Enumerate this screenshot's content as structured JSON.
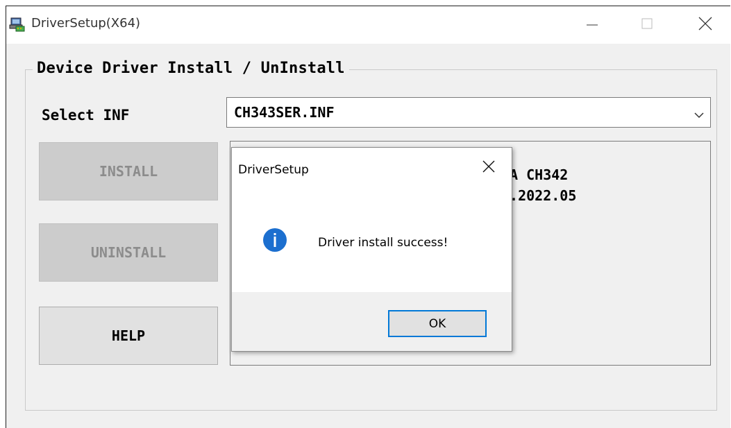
{
  "window": {
    "title": "DriverSetup(X64)",
    "icon": "driver-setup-app-icon",
    "controls": [
      "minimize-icon",
      "maximize-icon",
      "close-icon"
    ]
  },
  "group": {
    "title": "Device Driver Install / UnInstall"
  },
  "select_inf": {
    "label": "Select INF",
    "value": "CH343SER.INF"
  },
  "buttons": {
    "install": "INSTALL",
    "uninstall": "UNINSTALL",
    "help": "HELP"
  },
  "info": {
    "line1_visible": "-A CH342",
    "line2_visible": "1.2022.05"
  },
  "dialog": {
    "title": "DriverSetup",
    "icon": "info-icon",
    "message": "Driver install success!",
    "ok_label": "OK"
  },
  "colors": {
    "dialog_accent": "#0078d7",
    "info_icon": "#1c6fcf",
    "disabled_button": "#cccccc",
    "window_bg": "#f0f0f0"
  }
}
